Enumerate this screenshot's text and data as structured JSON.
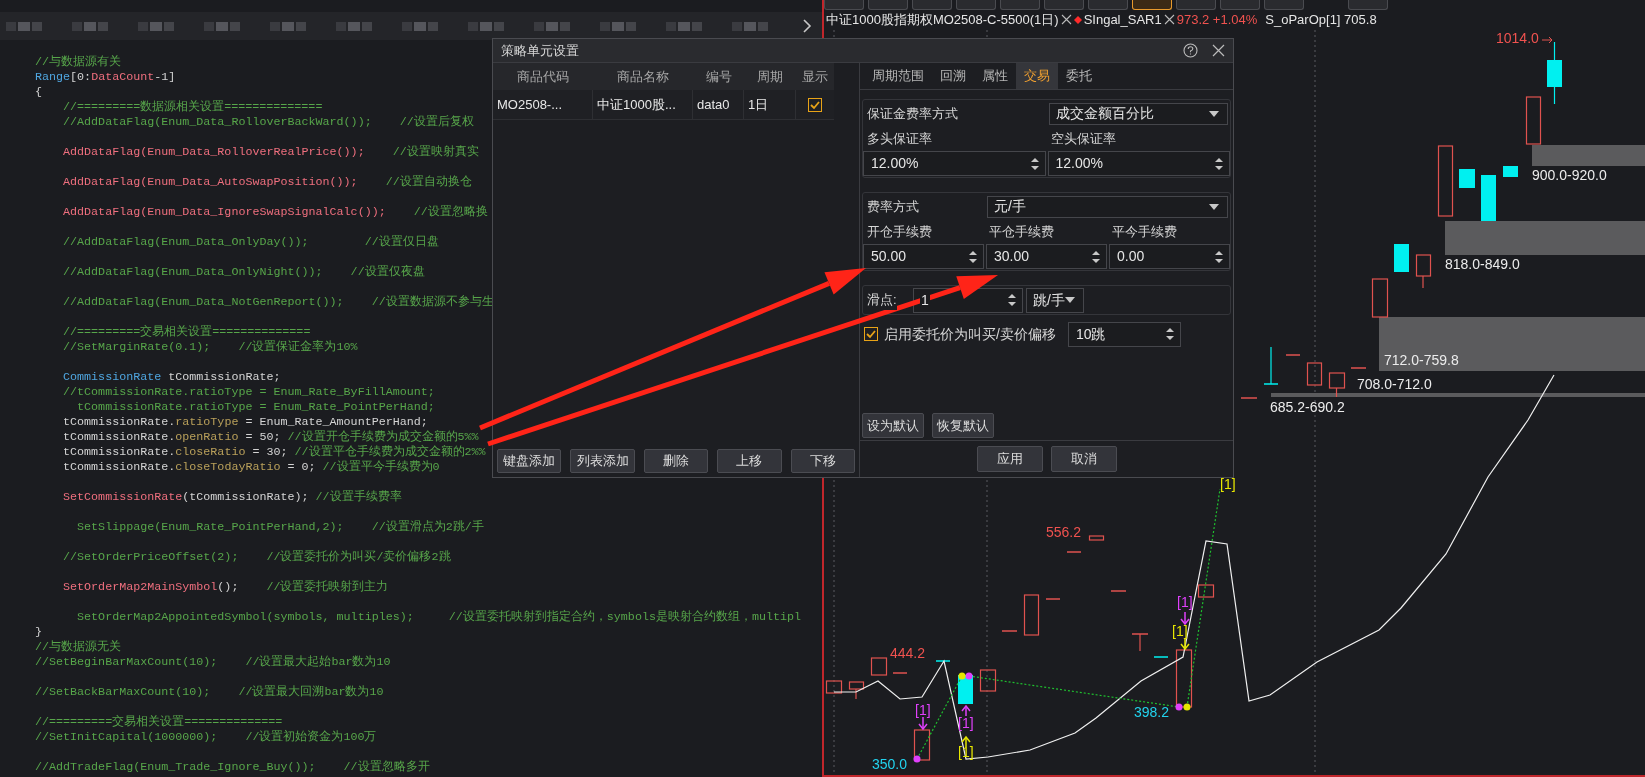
{
  "editor": {
    "code_lines": [
      {
        "kind": "code",
        "segments": [
          {
            "kind": "comment",
            "text": "//与数据源有关"
          }
        ]
      },
      {
        "kind": "code",
        "segments": [
          {
            "kind": "type",
            "text": "Range"
          },
          {
            "kind": "plain",
            "text": "[0:"
          },
          {
            "kind": "func",
            "text": "DataCount"
          },
          {
            "kind": "plain",
            "text": "-1]"
          }
        ]
      },
      {
        "kind": "code",
        "segments": [
          {
            "kind": "plain",
            "text": "{"
          }
        ]
      },
      {
        "kind": "code",
        "segments": [
          {
            "kind": "comment",
            "text": "    //=========数据源相关设置=============="
          }
        ]
      },
      {
        "kind": "code",
        "segments": [
          {
            "kind": "comment",
            "text": "    //AddDataFlag(Enum_Data_RolloverBackWard());    //设置后复权"
          }
        ]
      },
      {
        "kind": "blank"
      },
      {
        "kind": "code",
        "segments": [
          {
            "kind": "func",
            "text": "    AddDataFlag(Enum_Data_RolloverRealPrice());"
          },
          {
            "kind": "comment",
            "text": "    //设置映射真实"
          }
        ]
      },
      {
        "kind": "blank"
      },
      {
        "kind": "code",
        "segments": [
          {
            "kind": "func",
            "text": "    AddDataFlag(Enum_Data_AutoSwapPosition());"
          },
          {
            "kind": "comment",
            "text": "    //设置自动换仓"
          }
        ]
      },
      {
        "kind": "blank"
      },
      {
        "kind": "code",
        "segments": [
          {
            "kind": "func",
            "text": "    AddDataFlag(Enum_Data_IgnoreSwapSignalCalc());"
          },
          {
            "kind": "comment",
            "text": "    //设置忽略换"
          }
        ]
      },
      {
        "kind": "blank"
      },
      {
        "kind": "code",
        "segments": [
          {
            "kind": "comment",
            "text": "    //AddDataFlag(Enum_Data_OnlyDay());        //设置仅日盘"
          }
        ]
      },
      {
        "kind": "blank"
      },
      {
        "kind": "code",
        "segments": [
          {
            "kind": "comment",
            "text": "    //AddDataFlag(Enum_Data_OnlyNight());    //设置仅夜盘"
          }
        ]
      },
      {
        "kind": "blank"
      },
      {
        "kind": "code",
        "segments": [
          {
            "kind": "comment",
            "text": "    //AddDataFlag(Enum_Data_NotGenReport());    //设置数据源不参与生"
          }
        ]
      },
      {
        "kind": "blank"
      },
      {
        "kind": "code",
        "segments": [
          {
            "kind": "comment",
            "text": "    //=========交易相关设置=============="
          }
        ]
      },
      {
        "kind": "code",
        "segments": [
          {
            "kind": "comment",
            "text": "    //SetMarginRate(0.1);    //设置保证金率为10%"
          }
        ]
      },
      {
        "kind": "blank"
      },
      {
        "kind": "code",
        "segments": [
          {
            "kind": "type",
            "text": "    CommissionRate"
          },
          {
            "kind": "plain",
            "text": " tCommissionRate;"
          }
        ]
      },
      {
        "kind": "code",
        "segments": [
          {
            "kind": "comment",
            "text": "    //tCommissionRate.ratioType = Enum_Rate_ByFillAmount;"
          }
        ]
      },
      {
        "kind": "code",
        "segments": [
          {
            "kind": "comment",
            "text": "      tCommissionRate.ratioType = Enum_Rate_PointPerHand;"
          }
        ]
      },
      {
        "kind": "code",
        "segments": [
          {
            "kind": "plain",
            "text": "    tCommissionRate."
          },
          {
            "kind": "prop",
            "text": "ratioType"
          },
          {
            "kind": "plain",
            "text": " = Enum_Rate_AmountPerHand;"
          }
        ]
      },
      {
        "kind": "code",
        "segments": [
          {
            "kind": "plain",
            "text": "    tCommissionRate."
          },
          {
            "kind": "prop",
            "text": "openRatio"
          },
          {
            "kind": "plain",
            "text": " = 50; "
          },
          {
            "kind": "comment",
            "text": "//设置开仓手续费为成交金额的5%%"
          }
        ]
      },
      {
        "kind": "code",
        "segments": [
          {
            "kind": "plain",
            "text": "    tCommissionRate."
          },
          {
            "kind": "prop",
            "text": "closeRatio"
          },
          {
            "kind": "plain",
            "text": " = 30; "
          },
          {
            "kind": "comment",
            "text": "//设置平仓手续费为成交金额的2%%"
          }
        ]
      },
      {
        "kind": "code",
        "segments": [
          {
            "kind": "plain",
            "text": "    tCommissionRate."
          },
          {
            "kind": "prop",
            "text": "closeTodayRatio"
          },
          {
            "kind": "plain",
            "text": " = 0; "
          },
          {
            "kind": "comment",
            "text": "//设置平今手续费为0"
          }
        ]
      },
      {
        "kind": "blank"
      },
      {
        "kind": "code",
        "segments": [
          {
            "kind": "func",
            "text": "    SetCommissionRate"
          },
          {
            "kind": "plain",
            "text": "(tCommissionRate); "
          },
          {
            "kind": "comment",
            "text": "//设置手续费率"
          }
        ]
      },
      {
        "kind": "blank"
      },
      {
        "kind": "code",
        "segments": [
          {
            "kind": "comment",
            "text": "      SetSlippage(Enum_Rate_PointPerHand,2);    //设置滑点为2跳/手"
          }
        ]
      },
      {
        "kind": "blank"
      },
      {
        "kind": "code",
        "segments": [
          {
            "kind": "comment",
            "text": "    //SetOrderPriceOffset(2);    //设置委托价为叫买/卖价偏移2跳"
          }
        ]
      },
      {
        "kind": "blank"
      },
      {
        "kind": "code",
        "segments": [
          {
            "kind": "func",
            "text": "    SetOrderMap2MainSymbol"
          },
          {
            "kind": "plain",
            "text": "();    "
          },
          {
            "kind": "comment",
            "text": "//设置委托映射到主力"
          }
        ]
      },
      {
        "kind": "blank"
      },
      {
        "kind": "code",
        "segments": [
          {
            "kind": "comment",
            "text": "      SetOrderMap2AppointedSymbol(symbols, multiples);     //设置委托映射到指定合约，symbols是映射合约数组，multipl"
          }
        ]
      },
      {
        "kind": "code",
        "segments": [
          {
            "kind": "plain",
            "text": "}"
          }
        ]
      },
      {
        "kind": "code",
        "segments": [
          {
            "kind": "comment",
            "text": "//与数据源无关"
          }
        ]
      },
      {
        "kind": "code",
        "segments": [
          {
            "kind": "comment",
            "text": "//SetBeginBarMaxCount(10);    //设置最大起始bar数为10"
          }
        ]
      },
      {
        "kind": "blank"
      },
      {
        "kind": "code",
        "segments": [
          {
            "kind": "comment",
            "text": "//SetBackBarMaxCount(10);    //设置最大回溯bar数为10"
          }
        ]
      },
      {
        "kind": "blank"
      },
      {
        "kind": "code",
        "segments": [
          {
            "kind": "comment",
            "text": "//=========交易相关设置=============="
          }
        ]
      },
      {
        "kind": "code",
        "segments": [
          {
            "kind": "comment",
            "text": "//SetInitCapital(1000000);    //设置初始资金为100万"
          }
        ]
      },
      {
        "kind": "blank"
      },
      {
        "kind": "code",
        "segments": [
          {
            "kind": "comment",
            "text": "//AddTradeFlag(Enum_Trade_Ignore_Buy());    //设置忽略多开"
          }
        ]
      }
    ]
  },
  "chart": {
    "period_buttons": [
      {
        "selected": false
      },
      {
        "selected": false
      },
      {
        "selected": false
      },
      {
        "selected": false
      },
      {
        "selected": false
      },
      {
        "selected": false
      },
      {
        "selected": false
      },
      {
        "selected": true
      },
      {
        "selected": false
      },
      {
        "selected": false
      },
      {
        "selected": false
      },
      {
        "selected": false
      }
    ],
    "title": {
      "symbol": "中证1000股指期权MO2508-C-5500(1日)",
      "indicator": "SIngal_SAR1",
      "price": "973.2 +1.04%",
      "series": "S_oParOp[1] 705.8"
    },
    "labels": [
      {
        "text": "1014.0",
        "kind": "high"
      },
      {
        "text": "900.0-920.0",
        "kind": "zone"
      },
      {
        "text": "818.0-849.0",
        "kind": "zone"
      },
      {
        "text": "712.0-759.8",
        "kind": "zone"
      },
      {
        "text": "708.0-712.0",
        "kind": "zone"
      },
      {
        "text": "685.2-690.2",
        "kind": "zone"
      },
      {
        "text": "[1]",
        "kind": "sell"
      },
      {
        "text": "556.2",
        "kind": "high"
      },
      {
        "text": "[1]",
        "kind": "buy"
      },
      {
        "text": "[1]",
        "kind": "sell"
      },
      {
        "text": "444.2",
        "kind": "high"
      },
      {
        "text": "[1]",
        "kind": "buy"
      },
      {
        "text": "398.2",
        "kind": "low"
      },
      {
        "text": "[1]",
        "kind": "buy"
      },
      {
        "text": "[1]",
        "kind": "sell"
      },
      {
        "text": "350.0",
        "kind": "low"
      }
    ]
  },
  "dialog": {
    "title": "策略单元设置",
    "table": {
      "columns": [
        "商品代码",
        "商品名称",
        "编号",
        "周期",
        "显示"
      ],
      "rows": [
        {
          "cells": [
            "MO2508-...",
            "中证1000股...",
            "data0",
            "1日"
          ],
          "shown": true
        }
      ]
    },
    "list_buttons": [
      "键盘添加",
      "列表添加",
      "删除",
      "上移",
      "下移"
    ],
    "tabs": [
      {
        "label": "周期范围",
        "selected": false
      },
      {
        "label": "回溯",
        "selected": false
      },
      {
        "label": "属性",
        "selected": false
      },
      {
        "label": "交易",
        "selected": true
      },
      {
        "label": "委托",
        "selected": false
      }
    ],
    "margin_mode": {
      "label": "保证金费率方式",
      "value": "成交金额百分比"
    },
    "margins": [
      {
        "label": "多头保证率",
        "value": "12.00%"
      },
      {
        "label": "空头保证率",
        "value": "12.00%"
      }
    ],
    "fee_mode": {
      "label": "费率方式",
      "value": "元/手"
    },
    "fees": [
      {
        "label": "开仓手续费",
        "value": "50.00"
      },
      {
        "label": "平仓手续费",
        "value": "30.00"
      },
      {
        "label": "平今手续费",
        "value": "0.00"
      }
    ],
    "slippage": {
      "label": "滑点:",
      "value": "1",
      "unit": "跳/手"
    },
    "price_offset": {
      "label": "启用委托价为叫买/卖价偏移",
      "checked": true,
      "value": "10跳"
    },
    "default_buttons": [
      "设为默认",
      "恢复默认"
    ],
    "footer_buttons": [
      "应用",
      "取消"
    ]
  }
}
